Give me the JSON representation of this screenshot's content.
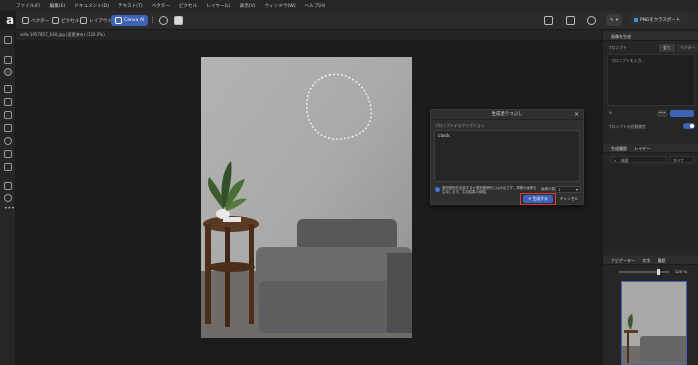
{
  "menu": [
    "ファイル(F)",
    "編集(E)",
    "ドキュメント(D)",
    "テキスト(T)",
    "ベクター",
    "ピクセル",
    "レイヤー(L)",
    "表示(V)",
    "ウィンドウ(W)",
    "ヘルプ(H)"
  ],
  "toolbar": {
    "vector_label": "ベクター",
    "pixel_label": "ピクセル",
    "layout_label": "レイアウト",
    "canva_label": "Canva AI",
    "export_label": "PNGをクラスポート"
  },
  "doc_tab": "sofa-1957857_640.jpg (変更済み) (120.0%)",
  "dialog": {
    "title": "生成塗りつぶし",
    "prompt_label": "プロンプトデスクリプション",
    "prompt_text": "clock",
    "checkbox_text": "選択範囲を拡張するか選択範囲外にはみ出さず、周囲の画像を生成します。生成結果の調整。",
    "count_label": "画像の数",
    "count_value": "1",
    "generate_label": "生成する",
    "cancel_label": "キャンセル"
  },
  "right_panel": {
    "header1": "画像を生成",
    "prompt_type_label": "プロンプト",
    "tab_all": "全て",
    "tab_vector": "ベクター",
    "prompt_placeholder": "プロンプトを入力...",
    "refine_label": "プロンプトの自動補完",
    "header2": "生成履歴",
    "header2b": "レイヤー",
    "search_placeholder": "検索",
    "filter_label": "すべて",
    "nav_tab1": "ナビゲーター",
    "nav_tab2": "文字",
    "nav_tab3": "履歴",
    "zoom_value": "120 %"
  }
}
